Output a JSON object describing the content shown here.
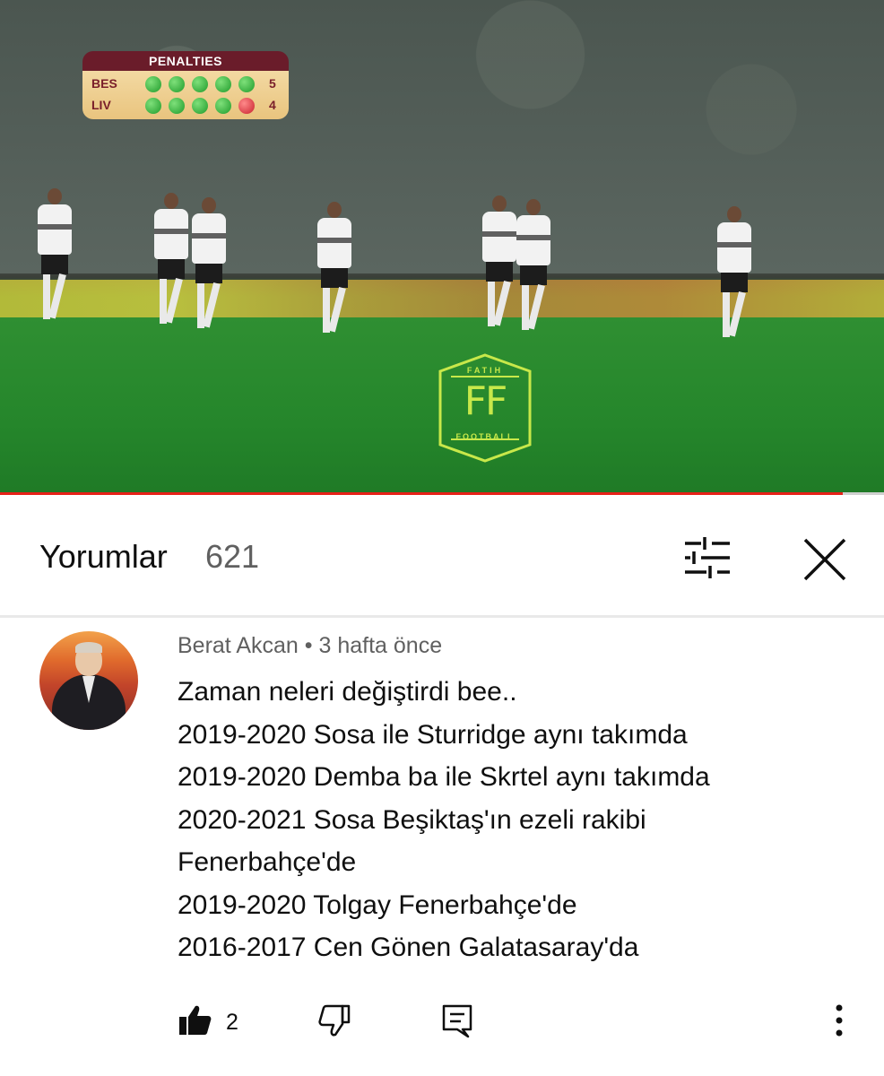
{
  "video": {
    "scoreboard": {
      "title": "PENALTIES",
      "rows": [
        {
          "team": "BES",
          "total": "5",
          "results": [
            "scored",
            "scored",
            "scored",
            "scored",
            "scored"
          ]
        },
        {
          "team": "LIV",
          "total": "4",
          "results": [
            "scored",
            "scored",
            "scored",
            "scored",
            "missed"
          ]
        }
      ]
    },
    "watermark": {
      "top_text": "FATIH",
      "monogram": "FF",
      "bottom_text": "FOOTBALL"
    },
    "progress_fraction": 0.953,
    "colors": {
      "progress": "#e62117",
      "scored": "#1f9a2a",
      "missed": "#c8202c"
    }
  },
  "comments_header": {
    "title": "Yorumlar",
    "count": "621",
    "filter_icon": "sort-sliders-icon",
    "close_icon": "close-icon"
  },
  "comment": {
    "author": "Berat Akcan",
    "separator": "•",
    "time": "3 hafta önce",
    "lines": [
      "Zaman neleri değiştirdi bee..",
      "2019-2020 Sosa ile Sturridge aynı takımda",
      "2019-2020 Demba ba ile Skrtel aynı takımda",
      "2020-2021 Sosa Beşiktaş'ın ezeli rakibi",
      "Fenerbahçe'de",
      "2019-2020 Tolgay Fenerbahçe'de",
      "2016-2017 Cen Gönen Galatasaray'da"
    ],
    "like_count": "2",
    "icons": {
      "like": "thumbs-up-icon",
      "dislike": "thumbs-down-icon",
      "reply": "reply-icon",
      "more": "more-vertical-icon"
    }
  }
}
